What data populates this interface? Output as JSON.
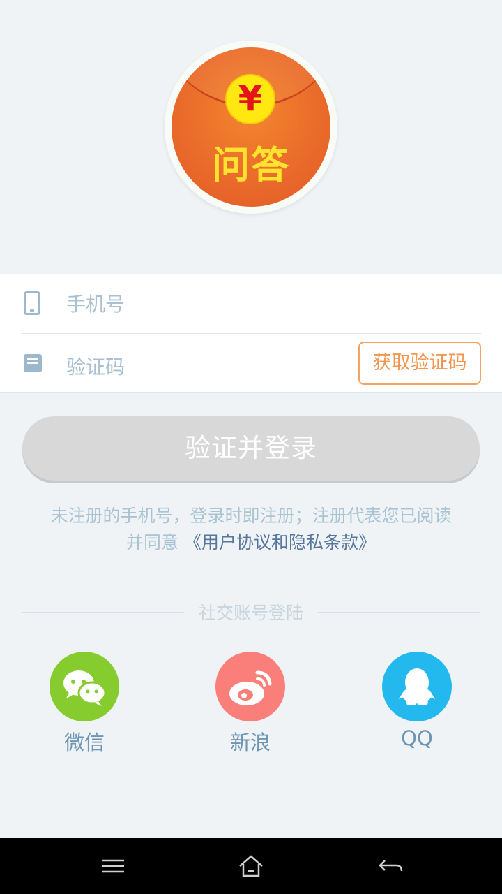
{
  "logo": {
    "coin_symbol": "¥",
    "text": "问答"
  },
  "form": {
    "phone": {
      "value": "",
      "placeholder": "手机号",
      "icon": "phone-icon"
    },
    "code": {
      "value": "",
      "placeholder": "验证码",
      "icon": "message-icon"
    },
    "get_code_label": "获取验证码"
  },
  "login_label": "验证并登录",
  "agreement": {
    "line1": "未注册的手机号，登录时即注册；注册代表您已阅读",
    "line2_prefix": "并同意",
    "link_text": "《用户协议和隐私条款》"
  },
  "social": {
    "heading": "社交账号登陆",
    "items": [
      {
        "label": "微信",
        "icon": "wechat-icon",
        "color": "#86cc2f"
      },
      {
        "label": "新浪",
        "icon": "weibo-icon",
        "color": "#fa7e7a"
      },
      {
        "label": "QQ",
        "icon": "qq-icon",
        "color": "#23b9ef"
      }
    ]
  },
  "colors": {
    "background": "#eff3f6",
    "accent_orange": "#f0964f",
    "login_disabled": "#d8d8d8",
    "link": "#56769b"
  },
  "nav": {
    "icons": [
      "menu-icon",
      "home-icon",
      "back-icon"
    ]
  }
}
